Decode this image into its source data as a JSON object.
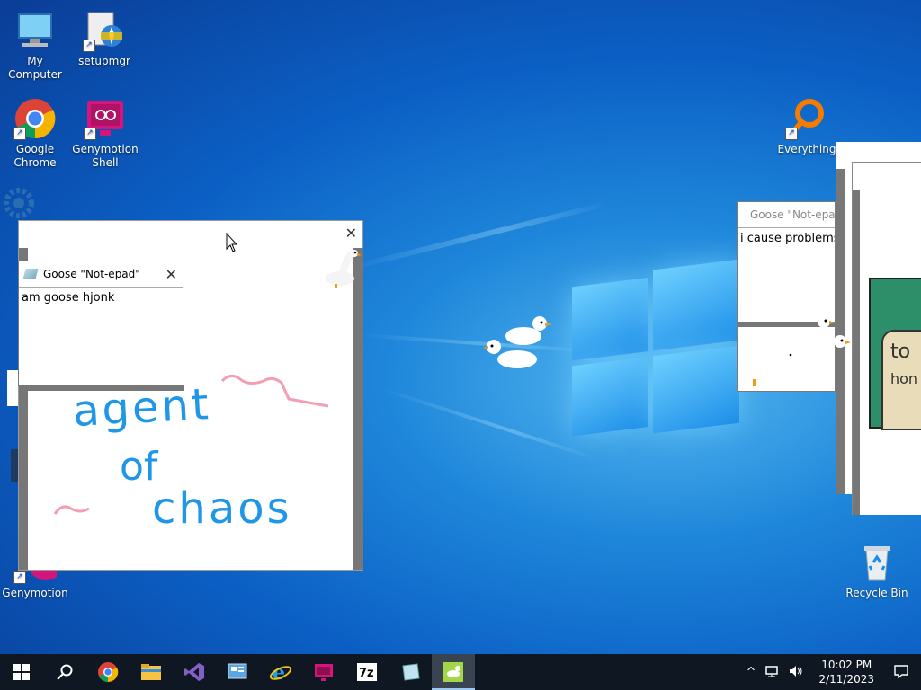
{
  "desktop": {
    "icons": [
      {
        "label": "My Computer"
      },
      {
        "label": "setupmgr"
      },
      {
        "label": "Google Chrome"
      },
      {
        "label": "Genymotion Shell"
      },
      {
        "label": "Everything"
      },
      {
        "label": "Genymotion"
      },
      {
        "label": "Recycle Bin"
      }
    ]
  },
  "windows": {
    "notepad_left": {
      "title": "Goose \"Not-epad\"",
      "text": "am goose hjonk"
    },
    "notepad_right": {
      "title": "Goose \"Not-epad\"",
      "text": "i cause problems"
    }
  },
  "drawing": {
    "words": [
      "agent",
      "of",
      "chaos"
    ]
  },
  "partial_right": {
    "letters": [
      "to",
      "hon"
    ]
  },
  "taskbar": {
    "items": [
      "start",
      "search",
      "chrome",
      "explorer",
      "visual-studio",
      "control-panel",
      "internet-explorer",
      "genymotion",
      "7zip",
      "notepad",
      "goose"
    ],
    "clock": {
      "time": "10:02 PM",
      "date": "2/11/2023"
    }
  },
  "colors": {
    "accent_pen_blue": "#1f96e6",
    "accent_pen_pink": "#f29fb3"
  }
}
